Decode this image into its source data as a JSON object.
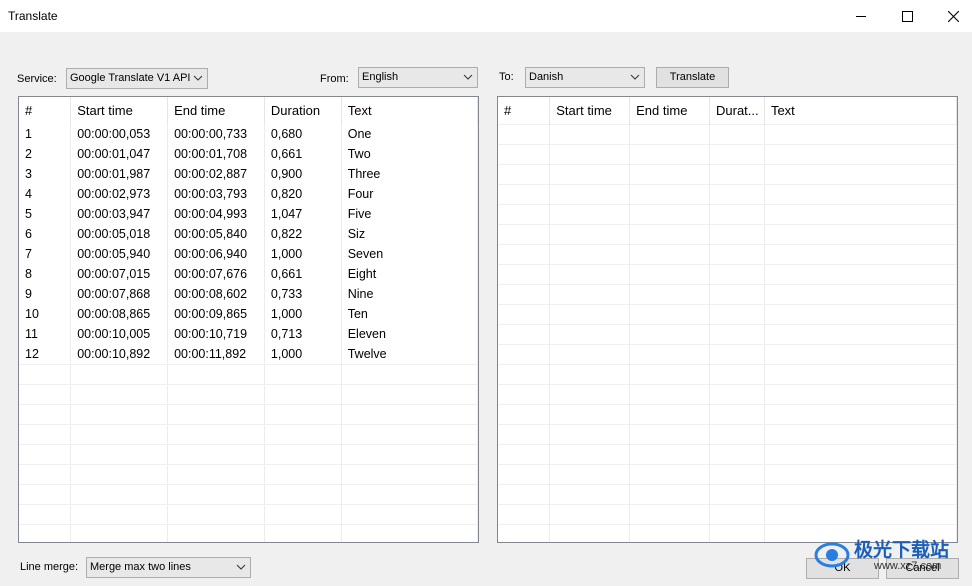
{
  "window": {
    "title": "Translate"
  },
  "service": {
    "label": "Service:",
    "value": "Google Translate V1 API"
  },
  "from": {
    "label": "From:",
    "value": "English"
  },
  "to": {
    "label": "To:",
    "value": "Danish"
  },
  "translate_button": "Translate",
  "source_grid": {
    "columns": [
      "#",
      "Start time",
      "End time",
      "Duration",
      "Text"
    ],
    "rows": [
      [
        "1",
        "00:00:00,053",
        "00:00:00,733",
        "0,680",
        "One"
      ],
      [
        "2",
        "00:00:01,047",
        "00:00:01,708",
        "0,661",
        "Two"
      ],
      [
        "3",
        "00:00:01,987",
        "00:00:02,887",
        "0,900",
        "Three"
      ],
      [
        "4",
        "00:00:02,973",
        "00:00:03,793",
        "0,820",
        "Four"
      ],
      [
        "5",
        "00:00:03,947",
        "00:00:04,993",
        "1,047",
        "Five"
      ],
      [
        "6",
        "00:00:05,018",
        "00:00:05,840",
        "0,822",
        "Siz"
      ],
      [
        "7",
        "00:00:05,940",
        "00:00:06,940",
        "1,000",
        "Seven"
      ],
      [
        "8",
        "00:00:07,015",
        "00:00:07,676",
        "0,661",
        "Eight"
      ],
      [
        "9",
        "00:00:07,868",
        "00:00:08,602",
        "0,733",
        "Nine"
      ],
      [
        "10",
        "00:00:08,865",
        "00:00:09,865",
        "1,000",
        "Ten"
      ],
      [
        "11",
        "00:00:10,005",
        "00:00:10,719",
        "0,713",
        "Eleven"
      ],
      [
        "12",
        "00:00:10,892",
        "00:00:11,892",
        "1,000",
        "Twelve"
      ]
    ]
  },
  "target_grid": {
    "columns": [
      "#",
      "Start time",
      "End time",
      "Durat...",
      "Text"
    ],
    "rows": []
  },
  "line_merge": {
    "label": "Line merge:",
    "value": "Merge max two lines"
  },
  "ok_button": "OK",
  "cancel_button": "Cancel",
  "watermark": {
    "text": "极光下载站",
    "url_text": "www.xz7.com"
  },
  "icons": [
    "minimize-icon",
    "maximize-icon",
    "close-icon",
    "chevron-down-icon"
  ]
}
